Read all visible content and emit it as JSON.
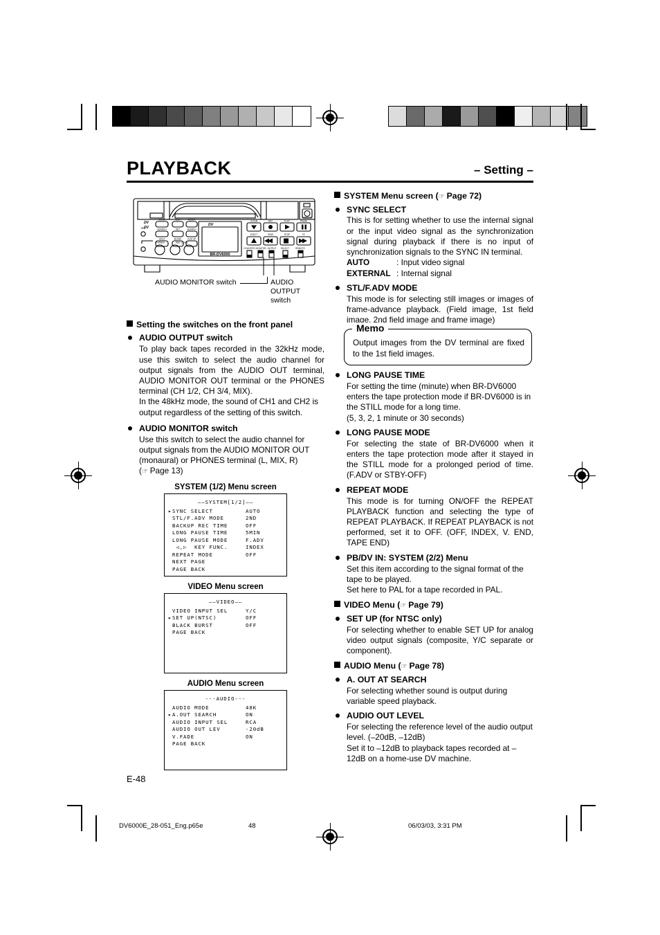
{
  "header": {
    "title": "PLAYBACK",
    "subtitle": "– Setting –"
  },
  "device": {
    "model_label": "BR-DV6000",
    "logo_label": "DV",
    "callout_audio_monitor": "AUDIO MONITOR switch",
    "callout_audio_output_l1": "AUDIO",
    "callout_audio_output_l2": "OUTPUT",
    "callout_audio_output_l3": "switch"
  },
  "left_column": {
    "section_heading": "Setting the switches on the front panel",
    "items": [
      {
        "title": "AUDIO OUTPUT switch",
        "paragraphs": [
          "To play back tapes recorded in the 32kHz mode, use this switch to select the audio channel for output signals from the AUDIO OUT terminal, AUDIO MONITOR OUT terminal or the PHONES terminal (CH 1/2, CH 3/4, MIX).",
          "In the 48kHz mode, the sound of CH1 and CH2 is output regardless of the setting of this switch."
        ]
      },
      {
        "title": "AUDIO MONITOR switch",
        "paragraphs": [
          "Use this switch to select the audio channel for output signals from the AUDIO MONITOR OUT (monaural) or PHONES terminal (L, MIX, R)"
        ],
        "page_ref": "Page 13"
      }
    ]
  },
  "menu_screens": [
    {
      "caption": "SYSTEM (1/2) Menu screen",
      "header": "——SYSTEM[1/2]——",
      "rows": [
        {
          "cursor": true,
          "label": "SYNC SELECT",
          "value": "AUTO"
        },
        {
          "cursor": false,
          "label": "STL/F.ADV MODE",
          "value": "2ND"
        },
        {
          "cursor": false,
          "label": "BACKUP REC TIME",
          "value": "OFF"
        },
        {
          "cursor": false,
          "label": "LONG PAUSE TIME",
          "value": "5MIN"
        },
        {
          "cursor": false,
          "label": "LONG PAUSE MODE",
          "value": "F.ADV"
        },
        {
          "cursor": false,
          "label": " ◁,▷  KEY FUNC.",
          "value": "INDEX"
        },
        {
          "cursor": false,
          "label": "REPEAT MODE",
          "value": "OFF"
        },
        {
          "cursor": false,
          "label": "NEXT PAGE",
          "value": ""
        },
        {
          "cursor": false,
          "label": "PAGE BACK",
          "value": ""
        }
      ]
    },
    {
      "caption": "VIDEO Menu screen",
      "header": "——VIDEO——",
      "rows": [
        {
          "cursor": false,
          "label": "VIDEO INPUT SEL",
          "value": "Y/C"
        },
        {
          "cursor": true,
          "label": "SET UP(NTSC)",
          "value": "OFF"
        },
        {
          "cursor": false,
          "label": "BLACK BURST",
          "value": "OFF"
        },
        {
          "cursor": false,
          "label": "PAGE BACK",
          "value": ""
        }
      ]
    },
    {
      "caption": "AUDIO Menu screen",
      "header": "---AUDIO---",
      "rows": [
        {
          "cursor": false,
          "label": "AUDIO MODE",
          "value": "48K"
        },
        {
          "cursor": true,
          "label": "A.OUT SEARCH",
          "value": "ON"
        },
        {
          "cursor": false,
          "label": "AUDIO INPUT SEL",
          "value": "RCA"
        },
        {
          "cursor": false,
          "label": "AUDIO OUT LEV",
          "value": "-20dB"
        },
        {
          "cursor": false,
          "label": "V.FADE",
          "value": "ON"
        },
        {
          "cursor": false,
          "label": "PAGE BACK",
          "value": ""
        }
      ]
    }
  ],
  "right_column": {
    "system_menu": {
      "heading": "SYSTEM Menu screen (",
      "heading_page": "Page 72)",
      "items": [
        {
          "title": "SYNC SELECT",
          "paragraphs": [
            "This is for setting whether to use the internal signal or the input video signal as the synchronization signal during playback if there is no input of synchronization signals to the SYNC IN terminal."
          ],
          "kv": [
            {
              "key": "AUTO",
              "sep": ":",
              "val": "Input video signal"
            },
            {
              "key": "EXTERNAL",
              "sep": ":",
              "val": "Internal signal"
            }
          ]
        },
        {
          "title": "STL/F.ADV MODE",
          "paragraphs": [
            "This mode is for selecting  still images or images of frame-advance playback. (Field image, 1st field image, 2nd field image and frame image)"
          ]
        },
        {
          "title": "LONG PAUSE TIME",
          "paragraphs": [
            "For setting the time (minute) when BR-DV6000 enters the tape protection mode if BR-DV6000 is in the STILL mode for a long time.",
            "(5, 3, 2, 1 minute or 30 seconds)"
          ]
        },
        {
          "title": "LONG PAUSE MODE",
          "paragraphs": [
            "For selecting the state of BR-DV6000 when it enters the tape protection mode after it stayed in the STILL mode for a prolonged period of time. (F.ADV or STBY-OFF)"
          ]
        },
        {
          "title": "REPEAT MODE",
          "paragraphs": [
            "This mode is for turning ON/OFF the REPEAT PLAYBACK function and selecting the type of REPEAT PLAYBACK. If REPEAT PLAYBACK is not performed, set it to OFF. (OFF, INDEX, V. END, TAPE END)"
          ]
        },
        {
          "title": "PB/DV IN: SYSTEM (2/2) Menu",
          "paragraphs": [
            "Set this item according to the signal format of the tape to be played.",
            "Set here to PAL for a tape recorded in PAL."
          ]
        }
      ]
    },
    "memo": {
      "label": "Memo",
      "text": "Output images from the DV terminal are fixed to the 1st field images."
    },
    "video_menu": {
      "heading": "VIDEO Menu (",
      "heading_page": "Page 79)",
      "items": [
        {
          "title": "SET UP (for NTSC only)",
          "paragraphs": [
            "For selecting whether to enable SET UP for analog video output signals (composite, Y/C separate or component)."
          ]
        }
      ]
    },
    "audio_menu": {
      "heading": "AUDIO Menu (",
      "heading_page": "Page 78)",
      "items": [
        {
          "title": "A. OUT AT SEARCH",
          "paragraphs": [
            "For selecting whether sound is output during variable speed playback."
          ]
        },
        {
          "title": "AUDIO OUT LEVEL",
          "paragraphs": [
            "For selecting the reference level of the audio output level. (–20dB, –12dB)",
            "Set it to –12dB to playback tapes recorded at –12dB on a home-use DV machine."
          ]
        }
      ]
    }
  },
  "page_number": "E-48",
  "footer": {
    "filename": "DV6000E_28-051_Eng.p65e",
    "page": "48",
    "timestamp": "06/03/03, 3:31 PM"
  },
  "colors": {
    "ink": "#000000",
    "paper": "#ffffff",
    "wedge_left": [
      "#000000",
      "#1a1a1a",
      "#303030",
      "#4a4a4a",
      "#5e5e5e",
      "#808080",
      "#999999",
      "#b0b0b0",
      "#c8c8c8",
      "#e8e8e8",
      "#ffffff"
    ],
    "wedge_right": [
      "#dcdcdc",
      "#6a6a6a",
      "#ababab",
      "#1a1a1a",
      "#9a9a9a",
      "#4f4f4f",
      "#000000",
      "#efefef",
      "#b4b4b4",
      "#d8d8d8",
      "#838383"
    ]
  }
}
